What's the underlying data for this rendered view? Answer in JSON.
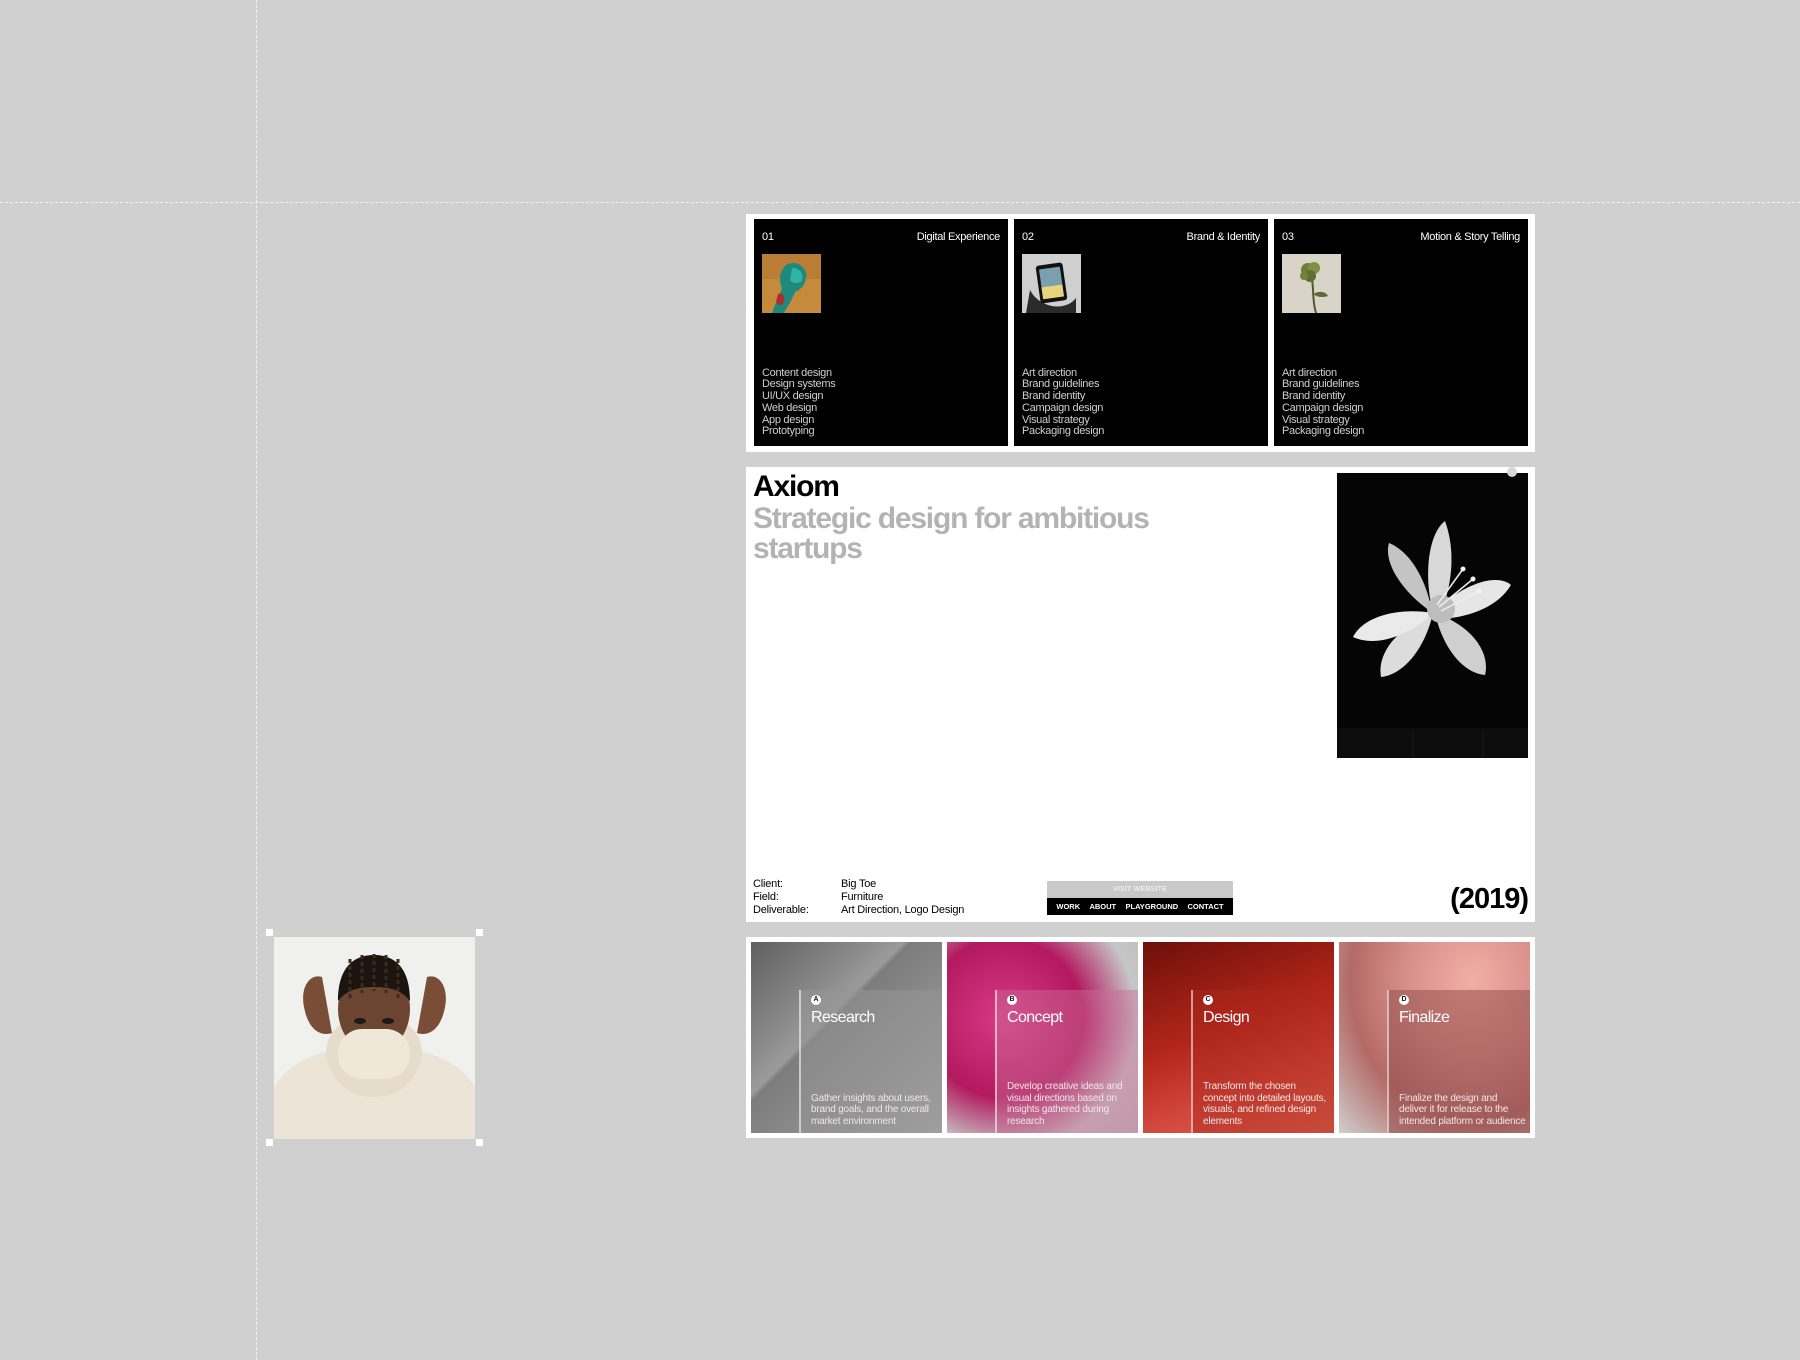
{
  "services": [
    {
      "num": "01",
      "title": "Digital Experience",
      "thumb": "green-figure-photo",
      "items": [
        "Content design",
        "Design systems",
        "UI/UX design",
        "Web design",
        "App design",
        "Prototyping"
      ]
    },
    {
      "num": "02",
      "title": "Brand & Identity",
      "thumb": "tablet-in-hand-photo",
      "items": [
        "Art direction",
        "Brand guidelines",
        "Brand identity",
        "Campaign design",
        "Visual strategy",
        "Packaging design"
      ]
    },
    {
      "num": "03",
      "title": "Motion & Story Telling",
      "thumb": "flower-stem-photo",
      "items": [
        "Art direction",
        "Brand guidelines",
        "Brand identity",
        "Campaign design",
        "Visual strategy",
        "Packaging design"
      ]
    }
  ],
  "project": {
    "name": "Axiom",
    "tagline": "Strategic design for ambitious startups",
    "image": "white-flower-photo",
    "meta": [
      {
        "key": "Client:",
        "value": "Big Toe"
      },
      {
        "key": "Field:",
        "value": "Furniture"
      },
      {
        "key": "Deliverable:",
        "value": "Art Direction, Logo Design"
      }
    ],
    "visit_label": "VISIT WEBSITE",
    "nav": [
      "WORK",
      "ABOUT",
      "PLAYGROUND",
      "CONTACT"
    ],
    "year": "(2019)"
  },
  "process": [
    {
      "letter": "A",
      "title": "Research",
      "desc": "Gather insights about users, brand goals, and the overall market environment",
      "color": "#8a8a8a"
    },
    {
      "letter": "B",
      "title": "Concept",
      "desc": "Develop creative ideas and visual directions based on insights gathered during research",
      "color": "#c8276f"
    },
    {
      "letter": "C",
      "title": "Design",
      "desc": "Transform the chosen concept into detailed layouts, visuals, and refined design elements",
      "color": "#a82418"
    },
    {
      "letter": "D",
      "title": "Finalize",
      "desc": "Finalize the design and deliver it for release to the intended platform or audience",
      "color": "#c98c84"
    }
  ],
  "floating_image": "person-pulling-collar-photo"
}
